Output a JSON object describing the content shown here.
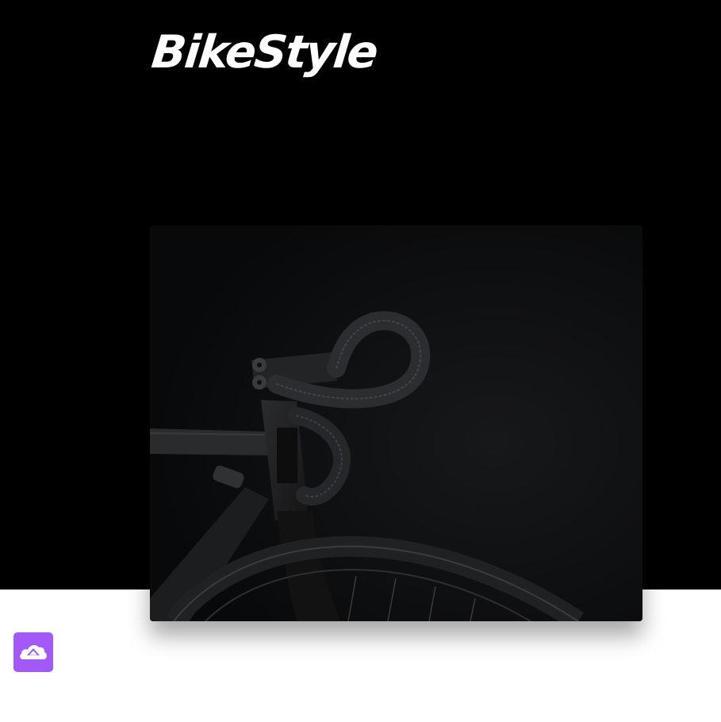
{
  "brand": {
    "name": "BikeStyle"
  },
  "hero": {
    "image_subject": "bicycle-handlebar-photo"
  },
  "scroll_top": {
    "icon": "cloud-upload-icon",
    "color": "#a259f7"
  },
  "colors": {
    "hero_background": "#000000",
    "page_background": "#ffffff",
    "accent": "#a259f7"
  }
}
